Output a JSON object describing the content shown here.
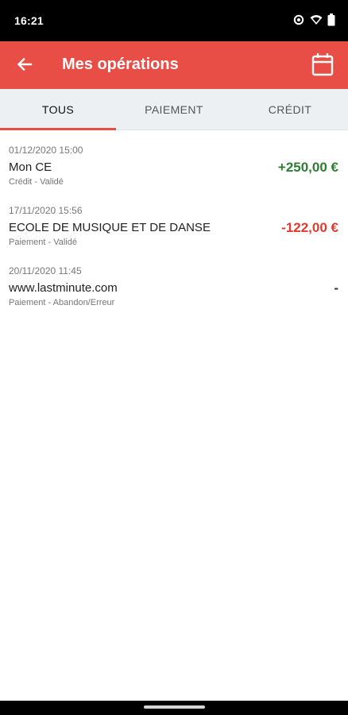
{
  "status_bar": {
    "time": "16:21",
    "icons": [
      "eye-icon",
      "wifi-icon",
      "battery-icon"
    ]
  },
  "app_bar": {
    "title": "Mes opérations",
    "back_icon": "arrow-left-icon",
    "calendar_icon": "calendar-icon",
    "color": "#e84e46"
  },
  "tabs": [
    {
      "label": "TOUS",
      "active": true
    },
    {
      "label": "PAIEMENT",
      "active": false
    },
    {
      "label": "CRÉDIT",
      "active": false
    }
  ],
  "operations": [
    {
      "date": "01/12/2020 15:00",
      "name": "Mon CE",
      "status": "Crédit - Validé",
      "amount": "+250,00 €",
      "amount_color": "#2e7d32"
    },
    {
      "date": "17/11/2020 15:56",
      "name": "ECOLE DE MUSIQUE ET DE DANSE",
      "status": "Paiement - Validé",
      "amount": "-122,00 €",
      "amount_color": "#e23a2e"
    },
    {
      "date": "20/11/2020 11:45",
      "name": "www.lastminute.com",
      "status": "Paiement - Abandon/Erreur",
      "amount": "-",
      "amount_color": "#333333"
    }
  ]
}
